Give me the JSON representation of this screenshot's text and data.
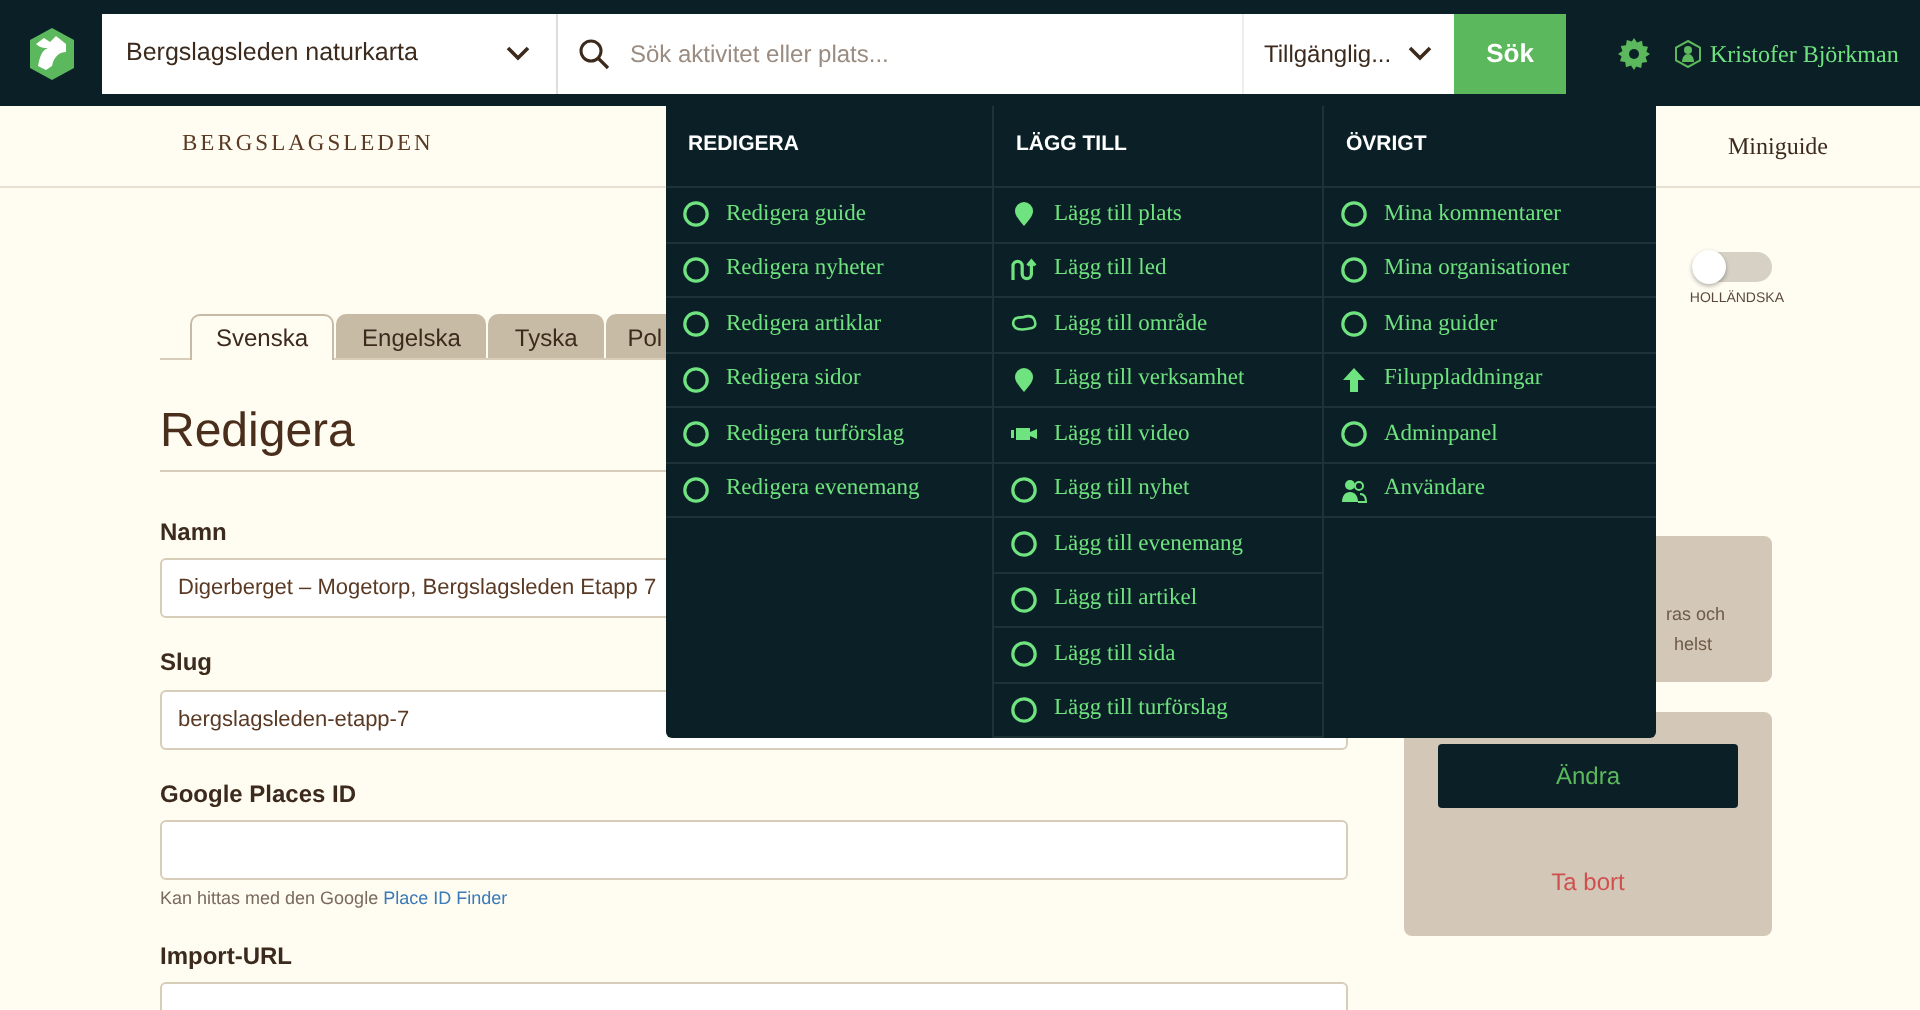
{
  "header": {
    "map_select": "Bergslagsleden naturkarta",
    "search": {
      "placeholder": "Sök aktivitet eller plats..."
    },
    "filter_select": "Tillgänglig...",
    "search_button": "Sök",
    "user": "Kristofer Björkman"
  },
  "subnav": {
    "site": "BERGSLAGSLEDEN",
    "link": "Miniguide"
  },
  "menu": {
    "columns": [
      {
        "heading": "REDIGERA",
        "items": [
          {
            "label": "Redigera guide",
            "kind": "circle"
          },
          {
            "label": "Redigera nyheter",
            "kind": "circle"
          },
          {
            "label": "Redigera artiklar",
            "kind": "circle"
          },
          {
            "label": "Redigera sidor",
            "kind": "circle"
          },
          {
            "label": "Redigera turförslag",
            "kind": "circle"
          },
          {
            "label": "Redigera evenemang",
            "kind": "circle"
          }
        ]
      },
      {
        "heading": "LÄGG TILL",
        "items": [
          {
            "label": "Lägg till plats",
            "kind": "pin"
          },
          {
            "label": "Lägg till led",
            "kind": "route"
          },
          {
            "label": "Lägg till område",
            "kind": "area"
          },
          {
            "label": "Lägg till verksamhet",
            "kind": "pin"
          },
          {
            "label": "Lägg till video",
            "kind": "video"
          },
          {
            "label": "Lägg till nyhet",
            "kind": "circle"
          },
          {
            "label": "Lägg till evenemang",
            "kind": "circle"
          },
          {
            "label": "Lägg till artikel",
            "kind": "circle"
          },
          {
            "label": "Lägg till sida",
            "kind": "circle"
          },
          {
            "label": "Lägg till turförslag",
            "kind": "circle"
          }
        ]
      },
      {
        "heading": "ÖVRIGT",
        "items": [
          {
            "label": "Mina kommentarer",
            "kind": "circle"
          },
          {
            "label": "Mina organisationer",
            "kind": "circle"
          },
          {
            "label": "Mina guider",
            "kind": "circle"
          },
          {
            "label": "Filuppladdningar",
            "kind": "upload"
          },
          {
            "label": "Adminpanel",
            "kind": "circle"
          },
          {
            "label": "Användare",
            "kind": "users"
          }
        ]
      }
    ]
  },
  "tabs": [
    {
      "label": "Svenska",
      "selected": true
    },
    {
      "label": "Engelska",
      "selected": false
    },
    {
      "label": "Tyska",
      "selected": false
    },
    {
      "label": "Pol",
      "selected": false
    }
  ],
  "language_toggle": {
    "label": "HOLLÄNDSKA",
    "on": false
  },
  "form": {
    "title": "Redigera",
    "fields": [
      {
        "label": "Namn",
        "value": "Digerberget – Mogetorp, Bergslagsleden Etapp 7"
      },
      {
        "label": "Slug",
        "value": "bergslagsleden-etapp-7"
      },
      {
        "label": "Google Places ID",
        "help": "Kan hittas med den Google",
        "help_link": "Place ID Finder"
      },
      {
        "label": "Import-URL"
      }
    ]
  },
  "sidebar": {
    "note_lines": [
      "ras och",
      "helst"
    ],
    "edit_button": "Ändra",
    "delete_link": "Ta bort"
  }
}
